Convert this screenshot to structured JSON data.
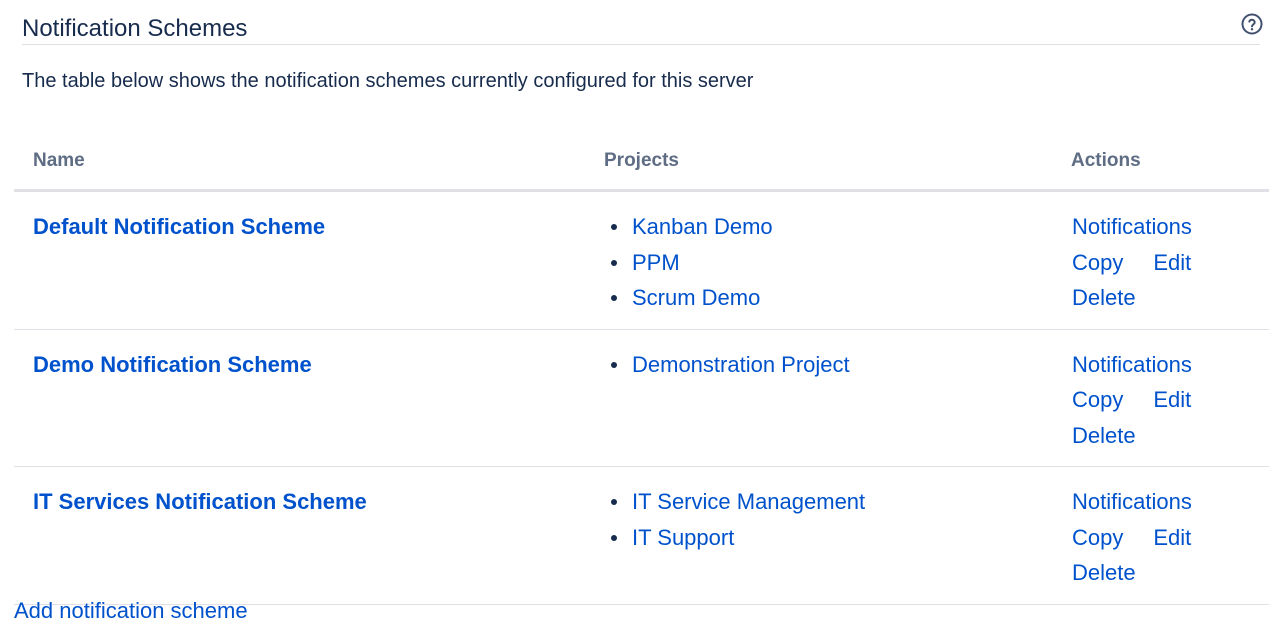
{
  "header": {
    "title": "Notification Schemes",
    "help_icon": "help-icon"
  },
  "description": "The table below shows the notification schemes currently configured for this server",
  "table": {
    "columns": [
      "Name",
      "Projects",
      "Actions"
    ],
    "rows": [
      {
        "name": "Default Notification Scheme",
        "projects": [
          "Kanban Demo",
          "PPM",
          "Scrum Demo"
        ],
        "actions": {
          "notifications": "Notifications",
          "copy": "Copy",
          "edit": "Edit",
          "delete": "Delete"
        }
      },
      {
        "name": "Demo Notification Scheme",
        "projects": [
          "Demonstration Project"
        ],
        "actions": {
          "notifications": "Notifications",
          "copy": "Copy",
          "edit": "Edit",
          "delete": "Delete"
        }
      },
      {
        "name": "IT Services Notification Scheme",
        "projects": [
          "IT Service Management",
          "IT Support"
        ],
        "actions": {
          "notifications": "Notifications",
          "copy": "Copy",
          "edit": "Edit",
          "delete": "Delete"
        }
      }
    ]
  },
  "footer": {
    "add_label": "Add notification scheme"
  },
  "colors": {
    "link": "#0052cc",
    "text": "#172b4d",
    "header_text": "#5e6c84",
    "border": "#dfe1e6"
  }
}
